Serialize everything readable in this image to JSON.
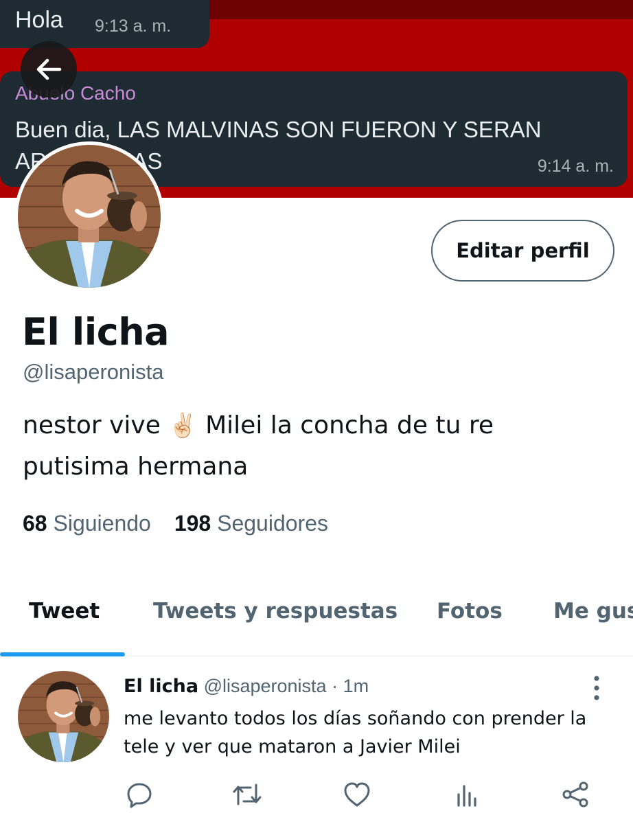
{
  "banner": {
    "chat": [
      {
        "text": "Hola",
        "time": "9:13 a. m."
      },
      {
        "sender": "Abuelo Cacho",
        "text": "Buen dia,  LAS MALVINAS SON FUERON Y SERAN ARGENTINAS",
        "time": "9:14 a. m."
      }
    ],
    "colors": {
      "background": "#b10000",
      "bubble": "#1e2b33",
      "sender": "#c78cd6"
    }
  },
  "header": {
    "back_icon": "arrow-left-icon"
  },
  "profile": {
    "edit_label": "Editar perfil",
    "display_name": "El licha",
    "handle": "@lisaperonista",
    "bio_part1": "nestor vive ",
    "bio_emoji": "✌🏻",
    "bio_part2": " Milei la concha de tu re putisima hermana",
    "following_count": "68",
    "following_label": "Siguiendo",
    "followers_count": "198",
    "followers_label": "Seguidores"
  },
  "tabs": [
    {
      "label": "Tweet",
      "active": true
    },
    {
      "label": "Tweets y respuestas",
      "active": false
    },
    {
      "label": "Fotos",
      "active": false
    },
    {
      "label": "Me gusta",
      "active": false
    }
  ],
  "tweet": {
    "name": "El licha",
    "handle": "@lisaperonista",
    "separator": " · ",
    "time": "1m",
    "text": "me levanto todos los días soñando con prender la tele y ver que mataron a Javier Milei",
    "actions": [
      "reply-icon",
      "retweet-icon",
      "like-icon",
      "analytics-icon",
      "share-icon"
    ]
  },
  "colors": {
    "accent": "#1d9bf0",
    "secondary_text": "#536471",
    "primary_text": "#0f1419"
  }
}
